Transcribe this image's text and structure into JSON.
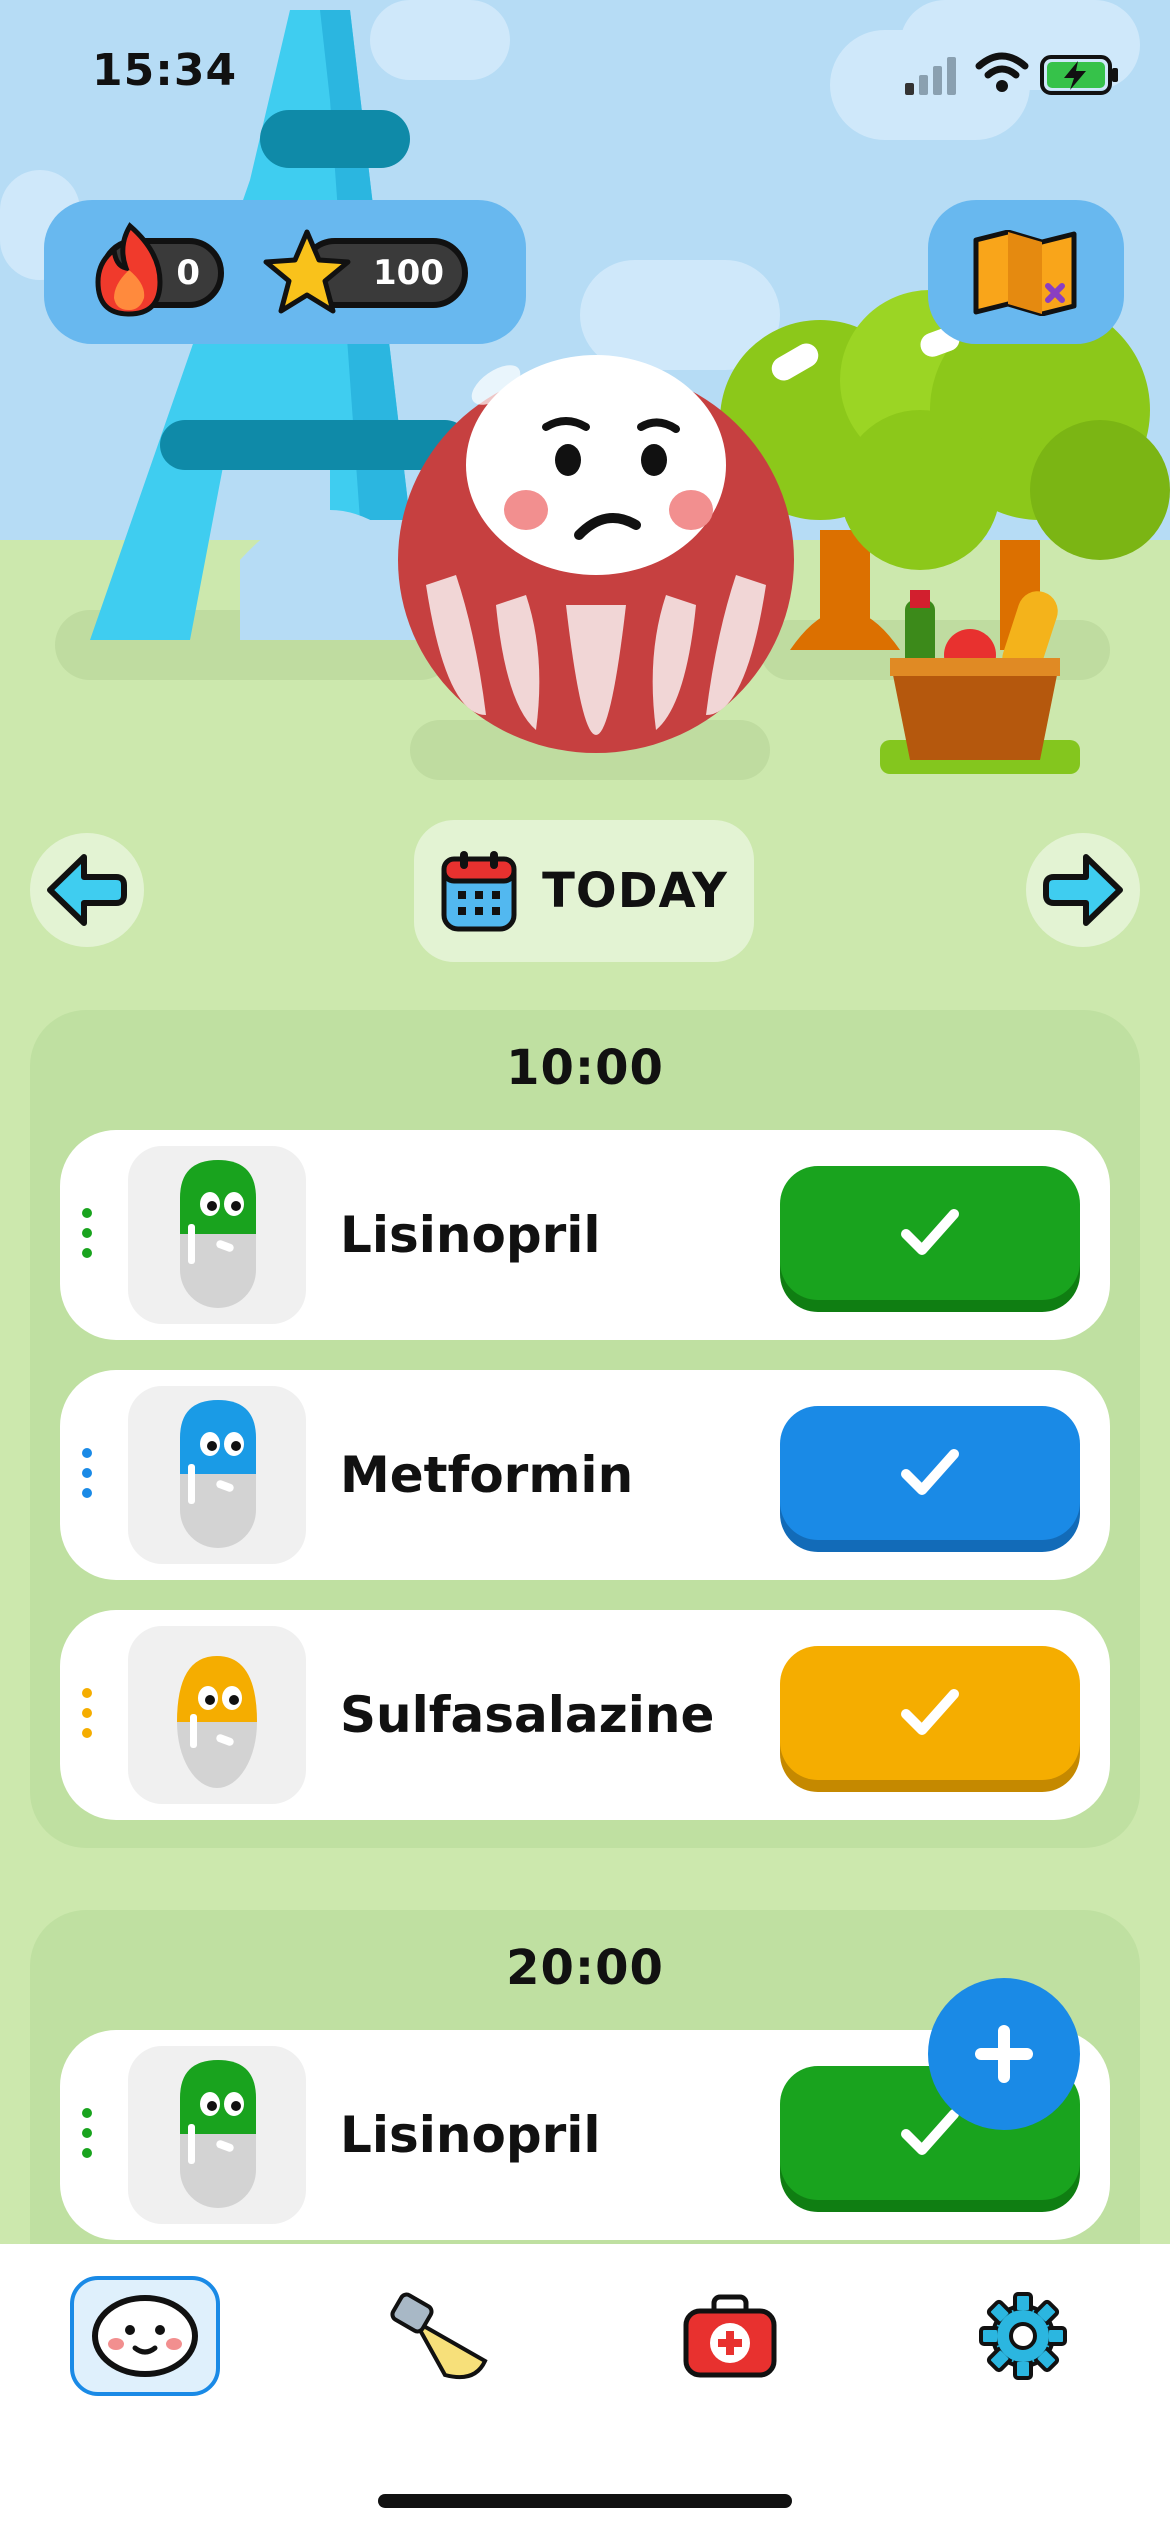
{
  "status_bar": {
    "time": "15:34"
  },
  "stats": {
    "streak": "0",
    "stars": "100"
  },
  "nav": {
    "day_label": "TODAY"
  },
  "groups": [
    {
      "time": "10:00",
      "medications": [
        {
          "name": "Lisinopril",
          "color": "#19a31e"
        },
        {
          "name": "Metformin",
          "color": "#1a8ae6"
        },
        {
          "name": "Sulfasalazine",
          "color": "#f5ad00"
        }
      ]
    },
    {
      "time": "20:00",
      "medications": [
        {
          "name": "Lisinopril",
          "color": "#19a31e"
        }
      ]
    }
  ],
  "tabs": [
    {
      "icon": "daruma-face-icon",
      "active": true
    },
    {
      "icon": "flashlight-icon",
      "active": false
    },
    {
      "icon": "first-aid-kit-icon",
      "active": false
    },
    {
      "icon": "gear-icon",
      "active": false
    }
  ],
  "colors": {
    "accent": "#1a8ae6",
    "green": "#19a31e",
    "yellow": "#f5ad00",
    "background": "#cce8ad"
  }
}
